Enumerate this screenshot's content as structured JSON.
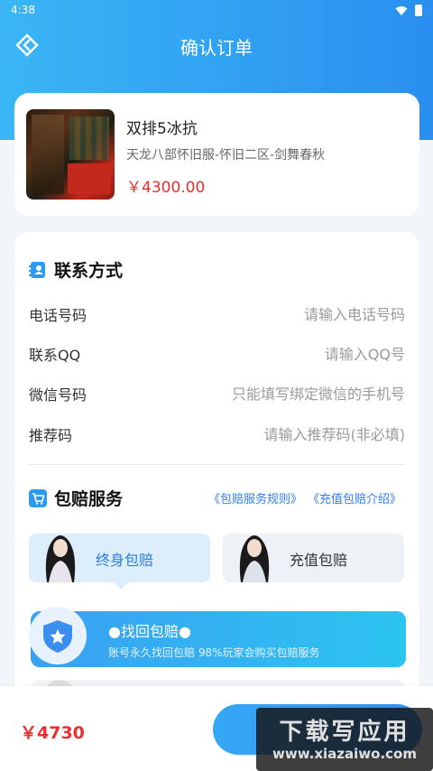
{
  "status_bar": {
    "time": "4:38"
  },
  "header": {
    "title": "确认订单"
  },
  "product": {
    "name": "双排5冰抗",
    "server": "天龙八部怀旧服-怀旧二区-剑舞春秋",
    "price": "￥4300.00"
  },
  "contact": {
    "title": "联系方式",
    "fields": [
      {
        "label": "电话号码",
        "placeholder": "请输入电话号码"
      },
      {
        "label": "联系QQ",
        "placeholder": "请输入QQ号"
      },
      {
        "label": "微信号码",
        "placeholder": "只能填写绑定微信的手机号"
      },
      {
        "label": "推荐码",
        "placeholder": "请输入推荐码(非必填)"
      }
    ]
  },
  "service": {
    "title": "包赔服务",
    "rules_link": "《包赔服务规则》",
    "intro_link": "《充值包赔介绍》",
    "options": [
      {
        "label": "终身包赔",
        "selected": true
      },
      {
        "label": "充值包赔",
        "selected": false
      }
    ],
    "plan": {
      "title": "●找回包赔●",
      "desc": "账号永久找回包赔 98%玩家会购买包赔服务"
    }
  },
  "footer": {
    "total": "￥4730"
  },
  "watermark": {
    "title": "下载写应用",
    "url": "www.xiazaiwo.com"
  },
  "colors": {
    "accent": "#2d8ff0",
    "price": "#e8302f",
    "background": "#f2f5f9"
  }
}
